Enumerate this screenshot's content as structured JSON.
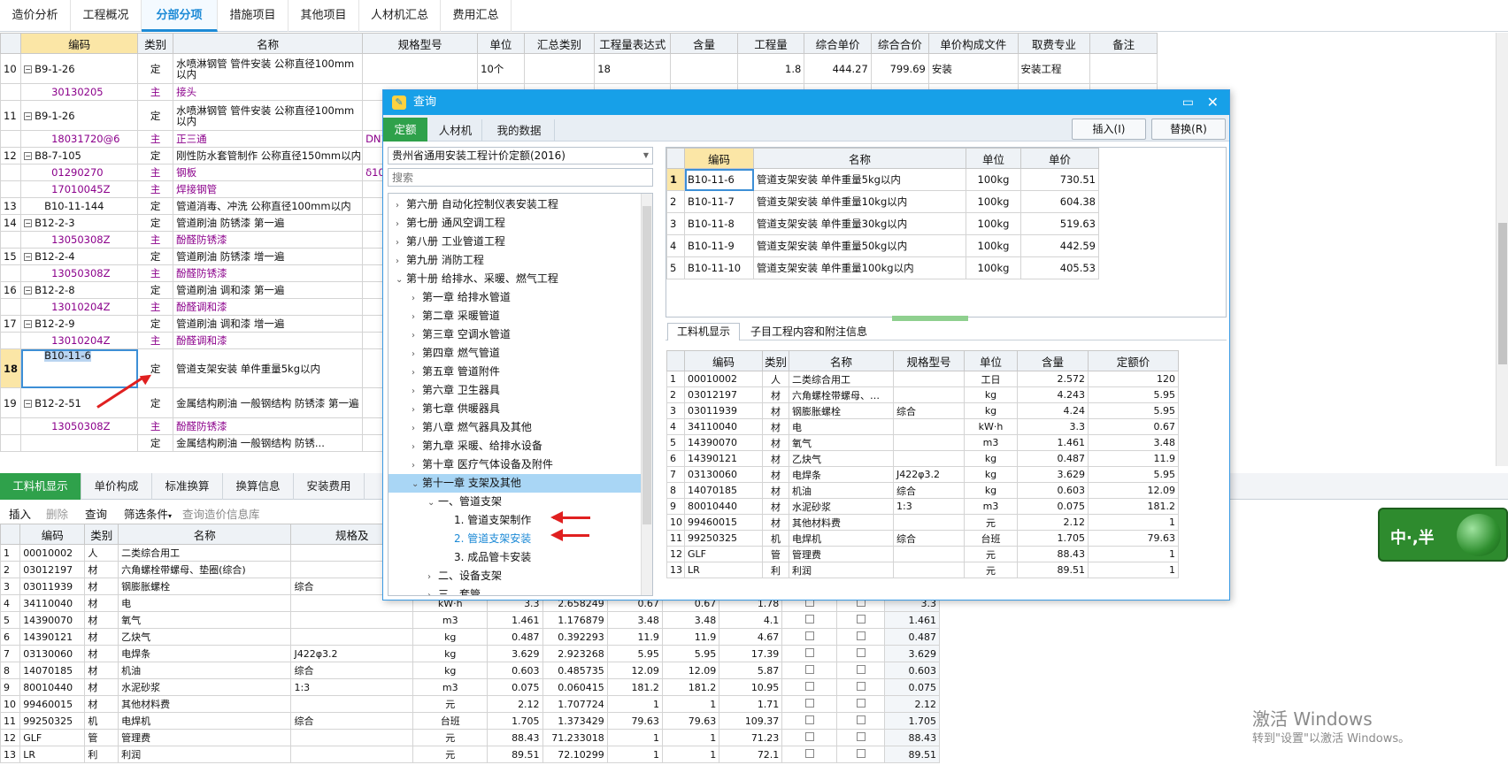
{
  "tabs": [
    "造价分析",
    "工程概况",
    "分部分项",
    "措施项目",
    "其他项目",
    "人材机汇总",
    "费用汇总"
  ],
  "main_headers": [
    "编码",
    "类别",
    "名称",
    "规格型号",
    "单位",
    "汇总类别",
    "工程量表达式",
    "含量",
    "工程量",
    "综合单价",
    "综合合价",
    "单价构成文件",
    "取费专业",
    "备注"
  ],
  "main_rows": [
    {
      "idx": "10",
      "code": "B9-1-26",
      "type": "定",
      "name": "水喷淋钢管 管件安装 公称直径100mm以内",
      "spec": "",
      "unit": "10个",
      "expr": "18",
      "qty": "1.8",
      "price": "444.27",
      "total": "799.69",
      "file": "安装",
      "major": "安装工程"
    },
    {
      "idx": "",
      "code": "30130205",
      "type": "主",
      "name": "接头",
      "sub": true
    },
    {
      "idx": "11",
      "code": "B9-1-26",
      "type": "定",
      "name": "水喷淋钢管 管件安装 公称直径100mm以内"
    },
    {
      "idx": "",
      "code": "18031720@6",
      "type": "主",
      "name": "正三通",
      "spec": "DN1",
      "sub": true
    },
    {
      "idx": "12",
      "code": "B8-7-105",
      "type": "定",
      "name": "刚性防水套管制作 公称直径150mm以内"
    },
    {
      "idx": "",
      "code": "01290270",
      "type": "主",
      "name": "钢板",
      "spec": "δ10",
      "sub": true
    },
    {
      "idx": "",
      "code": "17010045Z",
      "type": "主",
      "name": "焊接钢管",
      "sub": true
    },
    {
      "idx": "13",
      "code": "B10-11-144",
      "type": "定",
      "name": "管道消毒、冲洗 公称直径100mm以内"
    },
    {
      "idx": "14",
      "code": "B12-2-3",
      "type": "定",
      "name": "管道刷油 防锈漆 第一遍"
    },
    {
      "idx": "",
      "code": "13050308Z",
      "type": "主",
      "name": "酚醛防锈漆",
      "sub": true
    },
    {
      "idx": "15",
      "code": "B12-2-4",
      "type": "定",
      "name": "管道刷油 防锈漆 增一遍"
    },
    {
      "idx": "",
      "code": "13050308Z",
      "type": "主",
      "name": "酚醛防锈漆",
      "sub": true
    },
    {
      "idx": "16",
      "code": "B12-2-8",
      "type": "定",
      "name": "管道刷油 调和漆 第一遍"
    },
    {
      "idx": "",
      "code": "13010204Z",
      "type": "主",
      "name": "酚醛调和漆",
      "sub": true
    },
    {
      "idx": "17",
      "code": "B12-2-9",
      "type": "定",
      "name": "管道刷油 调和漆 增一遍"
    },
    {
      "idx": "",
      "code": "13010204Z",
      "type": "主",
      "name": "酚醛调和漆",
      "sub": true
    },
    {
      "idx": "18",
      "code": "B10-11-6",
      "type": "定",
      "name": "管道支架安装 单件重量5kg以内",
      "selected": true
    },
    {
      "idx": "19",
      "code": "B12-2-51",
      "type": "定",
      "name": "金属结构刷油 一般钢结构 防锈漆 第一遍"
    },
    {
      "idx": "",
      "code": "13050308Z",
      "type": "主",
      "name": "酚醛防锈漆",
      "sub": true
    },
    {
      "idx": "",
      "code": "",
      "type": "定",
      "name": "金属结构刷油 一般钢结构 防锈..."
    }
  ],
  "dialog": {
    "title": "查询",
    "tabs": [
      "定额",
      "人材机",
      "我的数据"
    ],
    "insert_btn": "插入(I)",
    "replace_btn": "替换(R)",
    "library": "贵州省通用安装工程计价定额(2016)",
    "search_placeholder": "搜索",
    "tree": [
      {
        "t": "第六册 自动化控制仪表安装工程",
        "lv": 0,
        "arr": "›"
      },
      {
        "t": "第七册 通风空调工程",
        "lv": 0,
        "arr": "›"
      },
      {
        "t": "第八册 工业管道工程",
        "lv": 0,
        "arr": "›"
      },
      {
        "t": "第九册 消防工程",
        "lv": 0,
        "arr": "›"
      },
      {
        "t": "第十册 给排水、采暖、燃气工程",
        "lv": 0,
        "arr": "⌄"
      },
      {
        "t": "第一章 给排水管道",
        "lv": 1,
        "arr": "›"
      },
      {
        "t": "第二章 采暖管道",
        "lv": 1,
        "arr": "›"
      },
      {
        "t": "第三章 空调水管道",
        "lv": 1,
        "arr": "›"
      },
      {
        "t": "第四章 燃气管道",
        "lv": 1,
        "arr": "›"
      },
      {
        "t": "第五章 管道附件",
        "lv": 1,
        "arr": "›"
      },
      {
        "t": "第六章 卫生器具",
        "lv": 1,
        "arr": "›"
      },
      {
        "t": "第七章 供暖器具",
        "lv": 1,
        "arr": "›"
      },
      {
        "t": "第八章 燃气器具及其他",
        "lv": 1,
        "arr": "›"
      },
      {
        "t": "第九章 采暖、给排水设备",
        "lv": 1,
        "arr": "›"
      },
      {
        "t": "第十章 医疗气体设备及附件",
        "lv": 1,
        "arr": "›"
      },
      {
        "t": "第十一章 支架及其他",
        "lv": 1,
        "arr": "⌄",
        "sel": true
      },
      {
        "t": "一、管道支架",
        "lv": 2,
        "arr": "⌄"
      },
      {
        "t": "1. 管道支架制作",
        "lv": 3,
        "arr": ""
      },
      {
        "t": "2. 管道支架安装",
        "lv": 3,
        "arr": "",
        "blue": true
      },
      {
        "t": "3. 成品管卡安装",
        "lv": 3,
        "arr": ""
      },
      {
        "t": "二、设备支架",
        "lv": 2,
        "arr": "›"
      },
      {
        "t": "三、套管",
        "lv": 2,
        "arr": "›"
      }
    ],
    "quota_headers": [
      "编码",
      "名称",
      "单位",
      "单价"
    ],
    "quota_rows": [
      [
        "1",
        "B10-11-6",
        "管道支架安装 单件重量5kg以内",
        "100kg",
        "730.51"
      ],
      [
        "2",
        "B10-11-7",
        "管道支架安装 单件重量10kg以内",
        "100kg",
        "604.38"
      ],
      [
        "3",
        "B10-11-8",
        "管道支架安装 单件重量30kg以内",
        "100kg",
        "519.63"
      ],
      [
        "4",
        "B10-11-9",
        "管道支架安装 单件重量50kg以内",
        "100kg",
        "442.59"
      ],
      [
        "5",
        "B10-11-10",
        "管道支架安装 单件重量100kg以内",
        "100kg",
        "405.53"
      ]
    ],
    "lower_tabs": [
      "工料机显示",
      "子目工程内容和附注信息"
    ],
    "res_headers": [
      "编码",
      "类别",
      "名称",
      "规格型号",
      "单位",
      "含量",
      "定额价"
    ],
    "res_rows": [
      [
        "1",
        "00010002",
        "人",
        "二类综合用工",
        "",
        "工日",
        "2.572",
        "120"
      ],
      [
        "2",
        "03012197",
        "材",
        "六角螺栓带螺母、…",
        "",
        "kg",
        "4.243",
        "5.95"
      ],
      [
        "3",
        "03011939",
        "材",
        "钢膨胀螺栓",
        "综合",
        "kg",
        "4.24",
        "5.95"
      ],
      [
        "4",
        "34110040",
        "材",
        "电",
        "",
        "kW·h",
        "3.3",
        "0.67"
      ],
      [
        "5",
        "14390070",
        "材",
        "氧气",
        "",
        "m3",
        "1.461",
        "3.48"
      ],
      [
        "6",
        "14390121",
        "材",
        "乙炔气",
        "",
        "kg",
        "0.487",
        "11.9"
      ],
      [
        "7",
        "03130060",
        "材",
        "电焊条",
        "J422φ3.2",
        "kg",
        "3.629",
        "5.95"
      ],
      [
        "8",
        "14070185",
        "材",
        "机油",
        "综合",
        "kg",
        "0.603",
        "12.09"
      ],
      [
        "9",
        "80010440",
        "材",
        "水泥砂浆",
        "1:3",
        "m3",
        "0.075",
        "181.2"
      ],
      [
        "10",
        "99460015",
        "材",
        "其他材料费",
        "",
        "元",
        "2.12",
        "1"
      ],
      [
        "11",
        "99250325",
        "机",
        "电焊机",
        "综合",
        "台班",
        "1.705",
        "79.63"
      ],
      [
        "12",
        "GLF",
        "管",
        "管理费",
        "",
        "元",
        "88.43",
        "1"
      ],
      [
        "13",
        "LR",
        "利",
        "利润",
        "",
        "元",
        "89.51",
        "1"
      ]
    ]
  },
  "bottom_tabs": [
    "工料机显示",
    "单价构成",
    "标准换算",
    "换算信息",
    "安装费用"
  ],
  "bottom_toolbar": [
    "插入",
    "删除",
    "查询",
    "筛选条件",
    "查询造价信息库"
  ],
  "bottom_headers": [
    "编码",
    "类别",
    "名称",
    "规格及"
  ],
  "bottom_rows": [
    [
      "1",
      "00010002",
      "人",
      "二类综合用工",
      "",
      "",
      "",
      "",
      "",
      "",
      ""
    ],
    [
      "2",
      "03012197",
      "材",
      "六角螺栓带螺母、垫圈(综合)",
      "",
      "",
      "",
      "",
      "",
      "",
      ""
    ],
    [
      "3",
      "03011939",
      "材",
      "钢膨胀螺栓",
      "综合",
      "",
      "",
      "",
      "",
      "",
      ""
    ],
    [
      "4",
      "34110040",
      "材",
      "电",
      "",
      "kW·h",
      "3.3",
      "2.658249",
      "0.67",
      "0.67",
      "1.78",
      "3.3"
    ],
    [
      "5",
      "14390070",
      "材",
      "氧气",
      "",
      "m3",
      "1.461",
      "1.176879",
      "3.48",
      "3.48",
      "4.1",
      "1.461"
    ],
    [
      "6",
      "14390121",
      "材",
      "乙炔气",
      "",
      "kg",
      "0.487",
      "0.392293",
      "11.9",
      "11.9",
      "4.67",
      "0.487"
    ],
    [
      "7",
      "03130060",
      "材",
      "电焊条",
      "J422φ3.2",
      "kg",
      "3.629",
      "2.923268",
      "5.95",
      "5.95",
      "17.39",
      "3.629"
    ],
    [
      "8",
      "14070185",
      "材",
      "机油",
      "综合",
      "kg",
      "0.603",
      "0.485735",
      "12.09",
      "12.09",
      "5.87",
      "0.603"
    ],
    [
      "9",
      "80010440",
      "材",
      "水泥砂浆",
      "1:3",
      "m3",
      "0.075",
      "0.060415",
      "181.2",
      "181.2",
      "10.95",
      "0.075"
    ],
    [
      "10",
      "99460015",
      "材",
      "其他材料费",
      "",
      "元",
      "2.12",
      "1.707724",
      "1",
      "1",
      "1.71",
      "2.12"
    ],
    [
      "11",
      "99250325",
      "机",
      "电焊机",
      "综合",
      "台班",
      "1.705",
      "1.373429",
      "79.63",
      "79.63",
      "109.37",
      "1.705"
    ],
    [
      "12",
      "GLF",
      "管",
      "管理费",
      "",
      "元",
      "88.43",
      "71.233018",
      "1",
      "1",
      "71.23",
      "88.43"
    ],
    [
      "13",
      "LR",
      "利",
      "利润",
      "",
      "元",
      "89.51",
      "72.10299",
      "1",
      "1",
      "72.1",
      "89.51"
    ]
  ],
  "ime": {
    "text": "中·,半"
  },
  "watermark": {
    "line1": "激活 Windows",
    "line2": "转到\"设置\"以激活 Windows。"
  }
}
